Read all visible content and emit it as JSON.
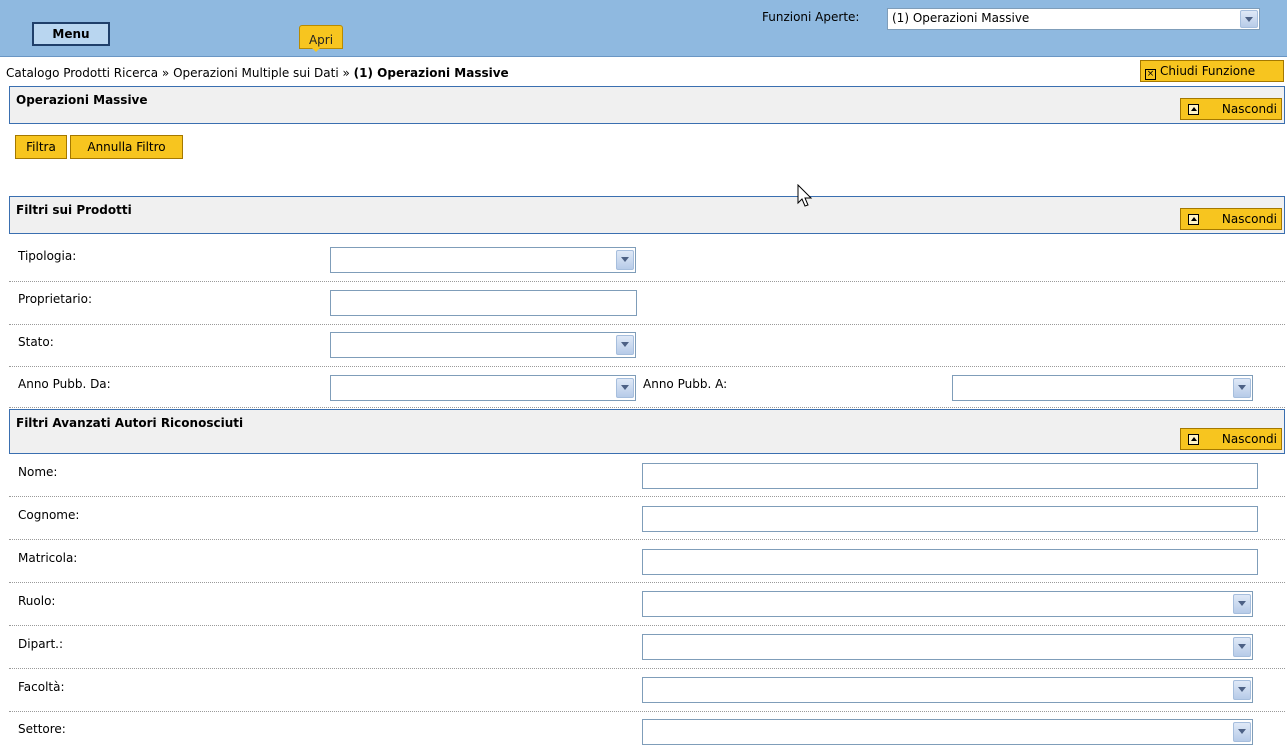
{
  "topbar": {
    "menu_label": "Menu",
    "apri_label": "Apri",
    "funzioni_label": "Funzioni Aperte:",
    "funzioni_selected": "(1) Operazioni Massive"
  },
  "breadcrumb": {
    "part1": "Catalogo Prodotti Ricerca",
    "separator": "»",
    "part2": "Operazioni Multiple sui Dati",
    "current": "(1) Operazioni Massive"
  },
  "chiudi_label": "Chiudi Funzione",
  "sections": {
    "operazioni": {
      "title": "Operazioni Massive",
      "toggle": "Nascondi"
    },
    "prodotti": {
      "title": "Filtri sui Prodotti",
      "toggle": "Nascondi"
    },
    "autori": {
      "title": "Filtri Avanzati Autori Riconosciuti",
      "toggle": "Nascondi"
    }
  },
  "buttons": {
    "filtra": "Filtra",
    "annulla": "Annulla Filtro"
  },
  "prodotti_fields": {
    "tipologia": "Tipologia:",
    "proprietario": "Proprietario:",
    "stato": "Stato:",
    "anno_da": "Anno Pubb. Da:",
    "anno_a": "Anno Pubb. A:"
  },
  "autori_fields": {
    "nome": "Nome:",
    "cognome": "Cognome:",
    "matricola": "Matricola:",
    "ruolo": "Ruolo:",
    "dipart": "Dipart.:",
    "facolta": "Facoltà:",
    "settore": "Settore:"
  },
  "colors": {
    "topbar": "#8fb9e0",
    "accent_button": "#f7c51f",
    "section_border": "#3a6fb0"
  }
}
